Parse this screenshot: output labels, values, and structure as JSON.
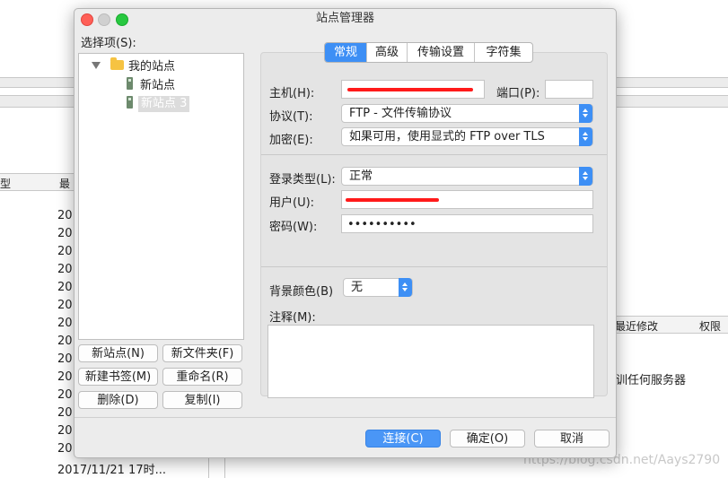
{
  "background": {
    "col_type": "型",
    "col_last": "最",
    "year_prefix": "20",
    "year_rows": [
      "20",
      "20",
      "20",
      "20",
      "20",
      "20",
      "20",
      "20",
      "20",
      "20",
      "20",
      "20",
      "20",
      "20"
    ],
    "last_row_date": "2017/11/21 17时...",
    "right_col_modified": "最近修改",
    "right_col_perms": "权限",
    "right_message": "训任何服务器",
    "watermark": "https://blog.csdn.net/Aays2790"
  },
  "dialog": {
    "title": "站点管理器",
    "select_label": "选择项(S):",
    "tree": {
      "root": "我的站点",
      "items": [
        "新站点",
        "新站点 3"
      ]
    },
    "left_buttons": {
      "new_site": "新站点(N)",
      "new_folder": "新文件夹(F)",
      "new_bookmark": "新建书签(M)",
      "rename": "重命名(R)",
      "delete": "删除(D)",
      "copy": "复制(I)"
    },
    "tabs": [
      "常规",
      "高级",
      "传输设置",
      "字符集"
    ],
    "form": {
      "host_label": "主机(H):",
      "host_value": "",
      "port_label": "端口(P):",
      "port_value": "",
      "protocol_label": "协议(T):",
      "protocol_value": "FTP - 文件传输协议",
      "encryption_label": "加密(E):",
      "encryption_value": "如果可用，使用显式的 FTP over TLS",
      "login_type_label": "登录类型(L):",
      "login_type_value": "正常",
      "user_label": "用户(U):",
      "user_value": "",
      "password_label": "密码(W):",
      "password_value": "••••••••••",
      "bg_color_label": "背景颜色(B)",
      "bg_color_value": "无",
      "comment_label": "注释(M):"
    },
    "footer_buttons": {
      "connect": "连接(C)",
      "ok": "确定(O)",
      "cancel": "取消"
    }
  }
}
